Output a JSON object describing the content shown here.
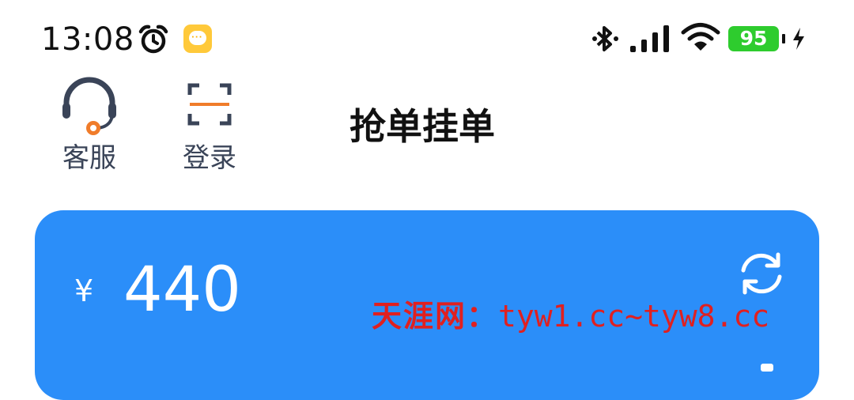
{
  "status_bar": {
    "time": "13:08",
    "battery_level": "95",
    "icons": [
      "alarm-clock-icon",
      "message-app-icon",
      "bluetooth-icon",
      "signal-icon",
      "wifi-icon",
      "battery-icon",
      "charging-bolt-icon"
    ]
  },
  "nav": {
    "service_label": "客服",
    "login_label": "登录",
    "title": "抢单挂单"
  },
  "balance": {
    "currency_symbol": "¥",
    "amount": "440"
  },
  "watermark": {
    "site_name": "天涯网：",
    "urls": "tyw1.cc~tyw8.cc"
  },
  "colors": {
    "card_blue": "#2b8ef9",
    "battery_green": "#2ecc2e",
    "accent_orange": "#f07c2a",
    "nav_icon_navy": "#3a4458",
    "watermark_red": "#e02020"
  }
}
